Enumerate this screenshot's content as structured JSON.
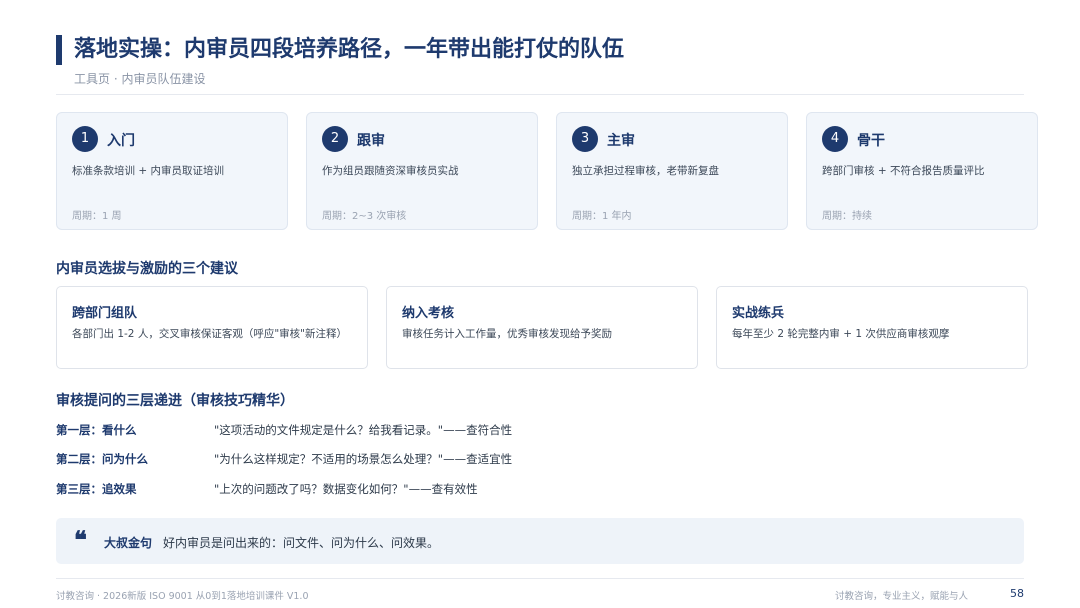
{
  "header": {
    "title": "落地实操：内审员四段培养路径，一年带出能打仗的队伍",
    "subtitle": "工具页 · 内审员队伍建设"
  },
  "stages": [
    {
      "num": "1",
      "name": "入门",
      "desc": "标准条款培训 + 内审员取证培训",
      "period": "周期：1 周"
    },
    {
      "num": "2",
      "name": "跟审",
      "desc": "作为组员跟随资深审核员实战",
      "period": "周期：2~3 次审核"
    },
    {
      "num": "3",
      "name": "主审",
      "desc": "独立承担过程审核，老带新复盘",
      "period": "周期：1 年内"
    },
    {
      "num": "4",
      "name": "骨干",
      "desc": "跨部门审核 + 不符合报告质量评比",
      "period": "周期：持续"
    }
  ],
  "suggestions": {
    "heading": "内审员选拔与激励的三个建议",
    "items": [
      {
        "title": "跨部门组队",
        "desc": "各部门出 1-2 人，交叉审核保证客观（呼应\"审核\"新注释）"
      },
      {
        "title": "纳入考核",
        "desc": "审核任务计入工作量，优秀审核发现给予奖励"
      },
      {
        "title": "实战练兵",
        "desc": "每年至少 2 轮完整内审 + 1 次供应商审核观摩"
      }
    ]
  },
  "questions": {
    "heading": "审核提问的三层递进（审核技巧精华）",
    "layers": [
      {
        "label": "第一层：看什么",
        "text": "\"这项活动的文件规定是什么？给我看记录。\"——查符合性"
      },
      {
        "label": "第二层：问为什么",
        "text": "\"为什么这样规定？不适用的场景怎么处理？\"——查适宜性"
      },
      {
        "label": "第三层：追效果",
        "text": "\"上次的问题改了吗？数据变化如何？\"——查有效性"
      }
    ]
  },
  "quote": {
    "icon": "quote-icon",
    "name": "大叔金句",
    "text": "好内审员是问出来的：问文件、问为什么、问效果。"
  },
  "footer": {
    "left": "讨教咨询 · 2026新版 ISO 9001 从0到1落地培训课件 V1.0",
    "right": "讨教咨询，专业主义，赋能与人",
    "page": "58"
  },
  "colors": {
    "primary": "#1e3a6e",
    "card_bg": "#f2f6fb",
    "quote_bg": "#eef3f9"
  }
}
